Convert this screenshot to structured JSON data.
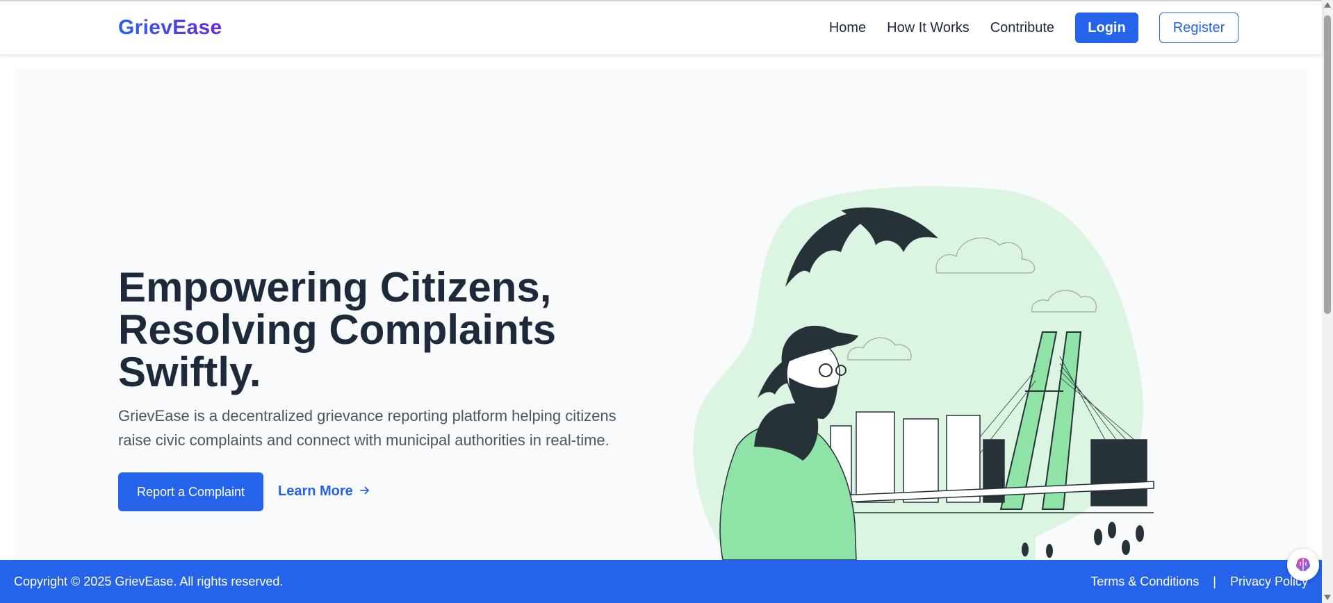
{
  "navbar": {
    "brand": "GrievEase",
    "links": [
      "Home",
      "How It Works",
      "Contribute"
    ],
    "login": "Login",
    "register": "Register"
  },
  "hero": {
    "title_lines": [
      "Empowering Citizens,",
      "Resolving Complaints",
      "Swiftly."
    ],
    "description": "GrievEase is a decentralized grievance reporting platform helping citizens raise civic complaints and connect with municipal authorities in real-time.",
    "report_button": "Report a Complaint",
    "learn_more": "Learn More",
    "learn_more_icon": "arrow-right-icon",
    "illustration": "person-city-bridge-illustration"
  },
  "footer": {
    "copyright": "Copyright © 2025 GrievEase. All rights reserved.",
    "terms": "Terms & Conditions",
    "separator": "|",
    "privacy": "Privacy Policy"
  },
  "colors": {
    "primary": "#2563eb",
    "brand_gradient_end": "#6d28d9",
    "hero_bg": "#f8fafc",
    "illustration_green": "#8fe3a6",
    "illustration_blob": "#dcf5e3",
    "illustration_dark": "#263238"
  }
}
